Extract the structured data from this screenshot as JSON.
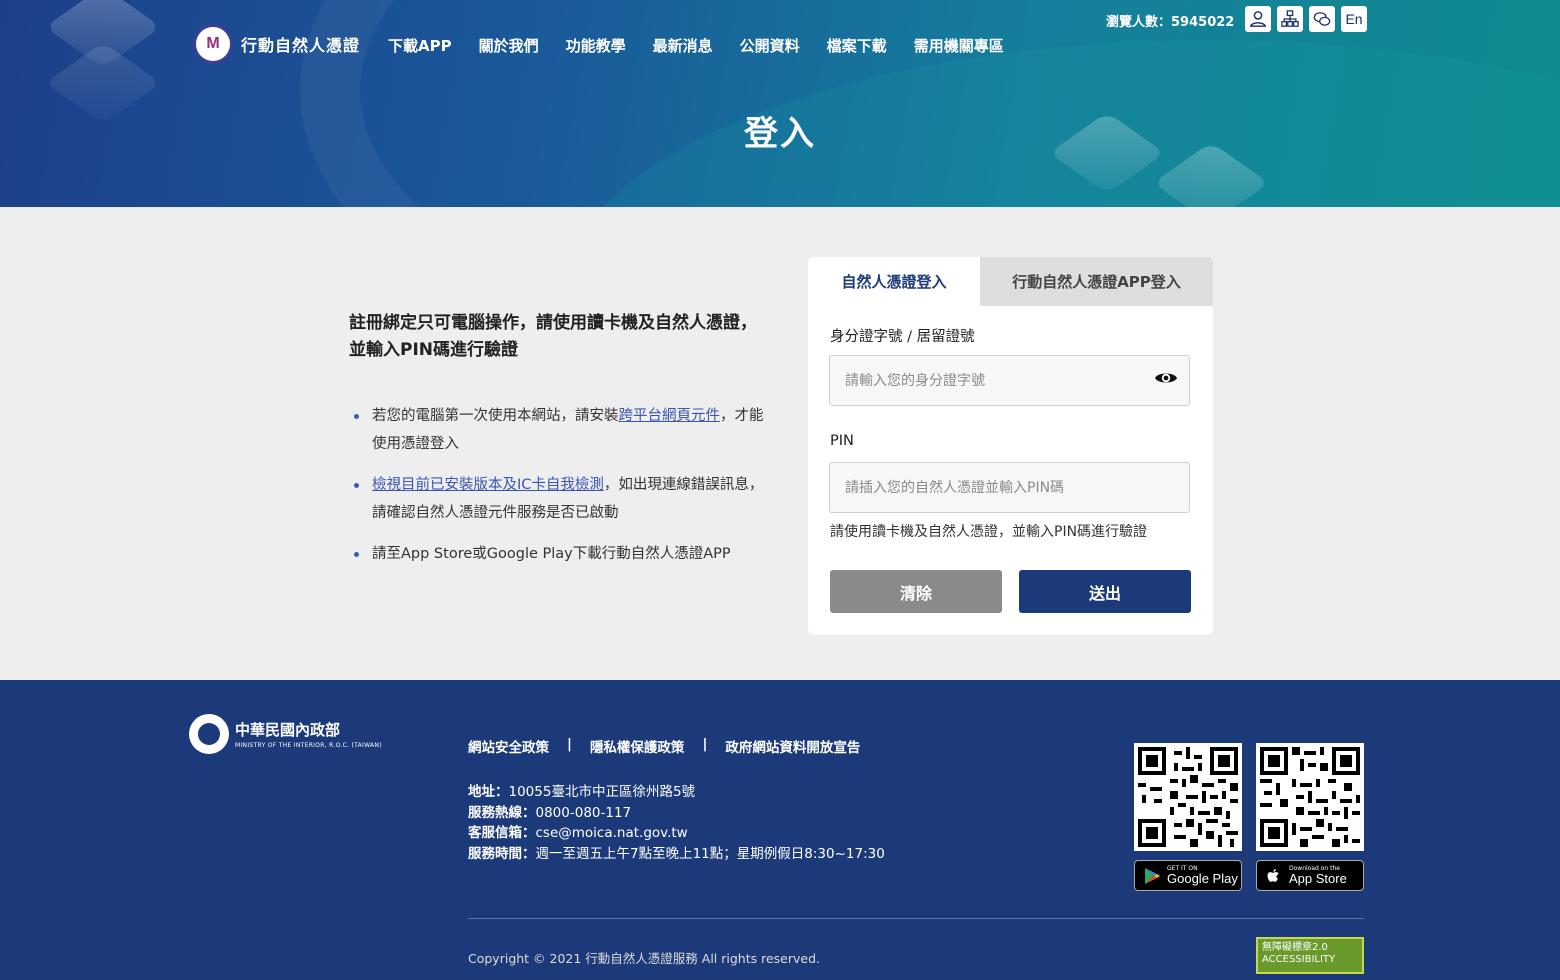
{
  "header": {
    "logo_text": "行動自然人憑證",
    "logo_mark": "M",
    "nav": [
      "下載APP",
      "關於我們",
      "功能教學",
      "最新消息",
      "公開資料",
      "檔案下載",
      "需用機關專區"
    ],
    "visitors_label": "瀏覽人數：",
    "visitors_count": "5945022",
    "lang_button": "En",
    "page_title": "登入"
  },
  "intro": {
    "heading": "註冊綁定只可電腦操作，請使用讀卡機及自然人憑證，並輸入PIN碼進行驗證",
    "bullet1_pre": "若您的電腦第一次使用本網站，請安裝",
    "bullet1_link": "跨平台網頁元件",
    "bullet1_post": "，才能使用憑證登入",
    "bullet2_link": "檢視目前已安裝版本及IC卡自我檢測",
    "bullet2_post": "，如出現連線錯誤訊息，請確認自然人憑證元件服務是否已啟動",
    "bullet3": "請至App Store或Google Play下載行動自然人憑證APP"
  },
  "login": {
    "tab_active": "自然人憑證登入",
    "tab_inactive": "行動自然人憑證APP登入",
    "id_label": "身分證字號 / 居留證號",
    "id_placeholder": "請輸入您的身分證字號",
    "pin_label": "PIN",
    "pin_placeholder": "請插入您的自然人憑證並輸入PIN碼",
    "hint": "請使用讀卡機及自然人憑證，並輸入PIN碼進行驗證",
    "clear_button": "清除",
    "submit_button": "送出"
  },
  "footer": {
    "org_name": "中華民國內政部",
    "org_name_en": "MINISTRY OF THE INTERIOR, R.O.C. (TAIWAN)",
    "links": [
      "網站安全政策",
      "隱私權保護政策",
      "政府網站資料開放宣告"
    ],
    "separator": "|",
    "address_label": "地址：",
    "address": "10055臺北市中正區徐州路5號",
    "hotline_label": "服務熱線：",
    "hotline": "0800-080-117",
    "email_label": "客服信箱：",
    "email": "cse@moica.nat.gov.tw",
    "hours_label": "服務時間：",
    "hours": "週一至週五上午7點至晚上11點；星期例假日8:30~17:30",
    "google_small": "GET IT ON",
    "google_name": "Google Play",
    "apple_small": "Download on the",
    "apple_name": "App Store",
    "copyright": "Copyright © 2021 行動自然人憑證服務 All rights reserved.",
    "a11y_line1": "無障礙標章2.0",
    "a11y_line2": "ACCESSIBILITY"
  },
  "colors": {
    "primary": "#1c3a7a",
    "link": "#3a55b4",
    "clear": "#8a8a8a"
  }
}
